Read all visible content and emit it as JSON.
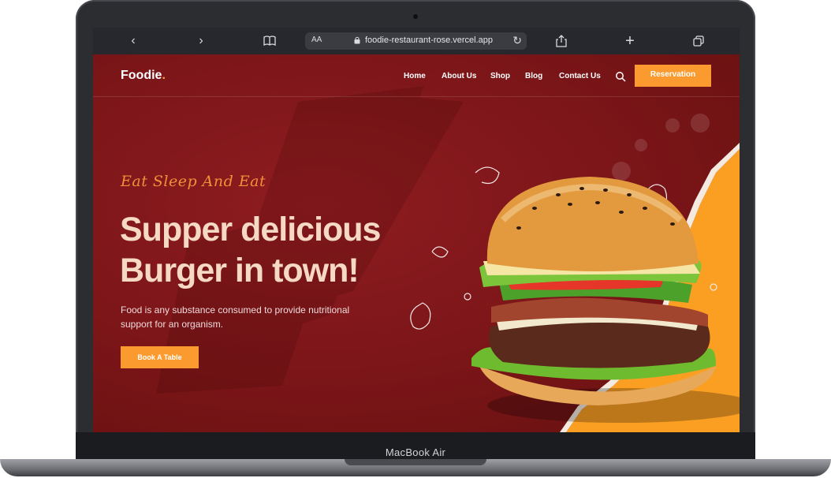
{
  "device": {
    "model": "MacBook Air"
  },
  "browser": {
    "url": "foodie-restaurant-rose.vercel.app",
    "text_size_label": "AA",
    "icons": [
      "back-icon",
      "forward-icon",
      "book-icon",
      "lock-icon",
      "reload-icon",
      "share-icon",
      "new-tab-icon",
      "tabs-icon"
    ]
  },
  "site": {
    "logo": "Foodie",
    "logo_dot": ".",
    "nav": [
      "Home",
      "About Us",
      "Shop",
      "Blog",
      "Contact Us"
    ],
    "reservation_label": "Reservation",
    "tagline": "Eat Sleep And Eat",
    "headline_line1": "Supper delicious",
    "headline_line2": "Burger in town!",
    "description": "Food is any substance consumed to provide nutritional support for an organism.",
    "book_label": "Book A Table"
  },
  "colors": {
    "background_red": "#7c1618",
    "accent_orange": "#fb9b2f",
    "headline": "#f6d9c5",
    "tagline": "#f28f3b"
  }
}
